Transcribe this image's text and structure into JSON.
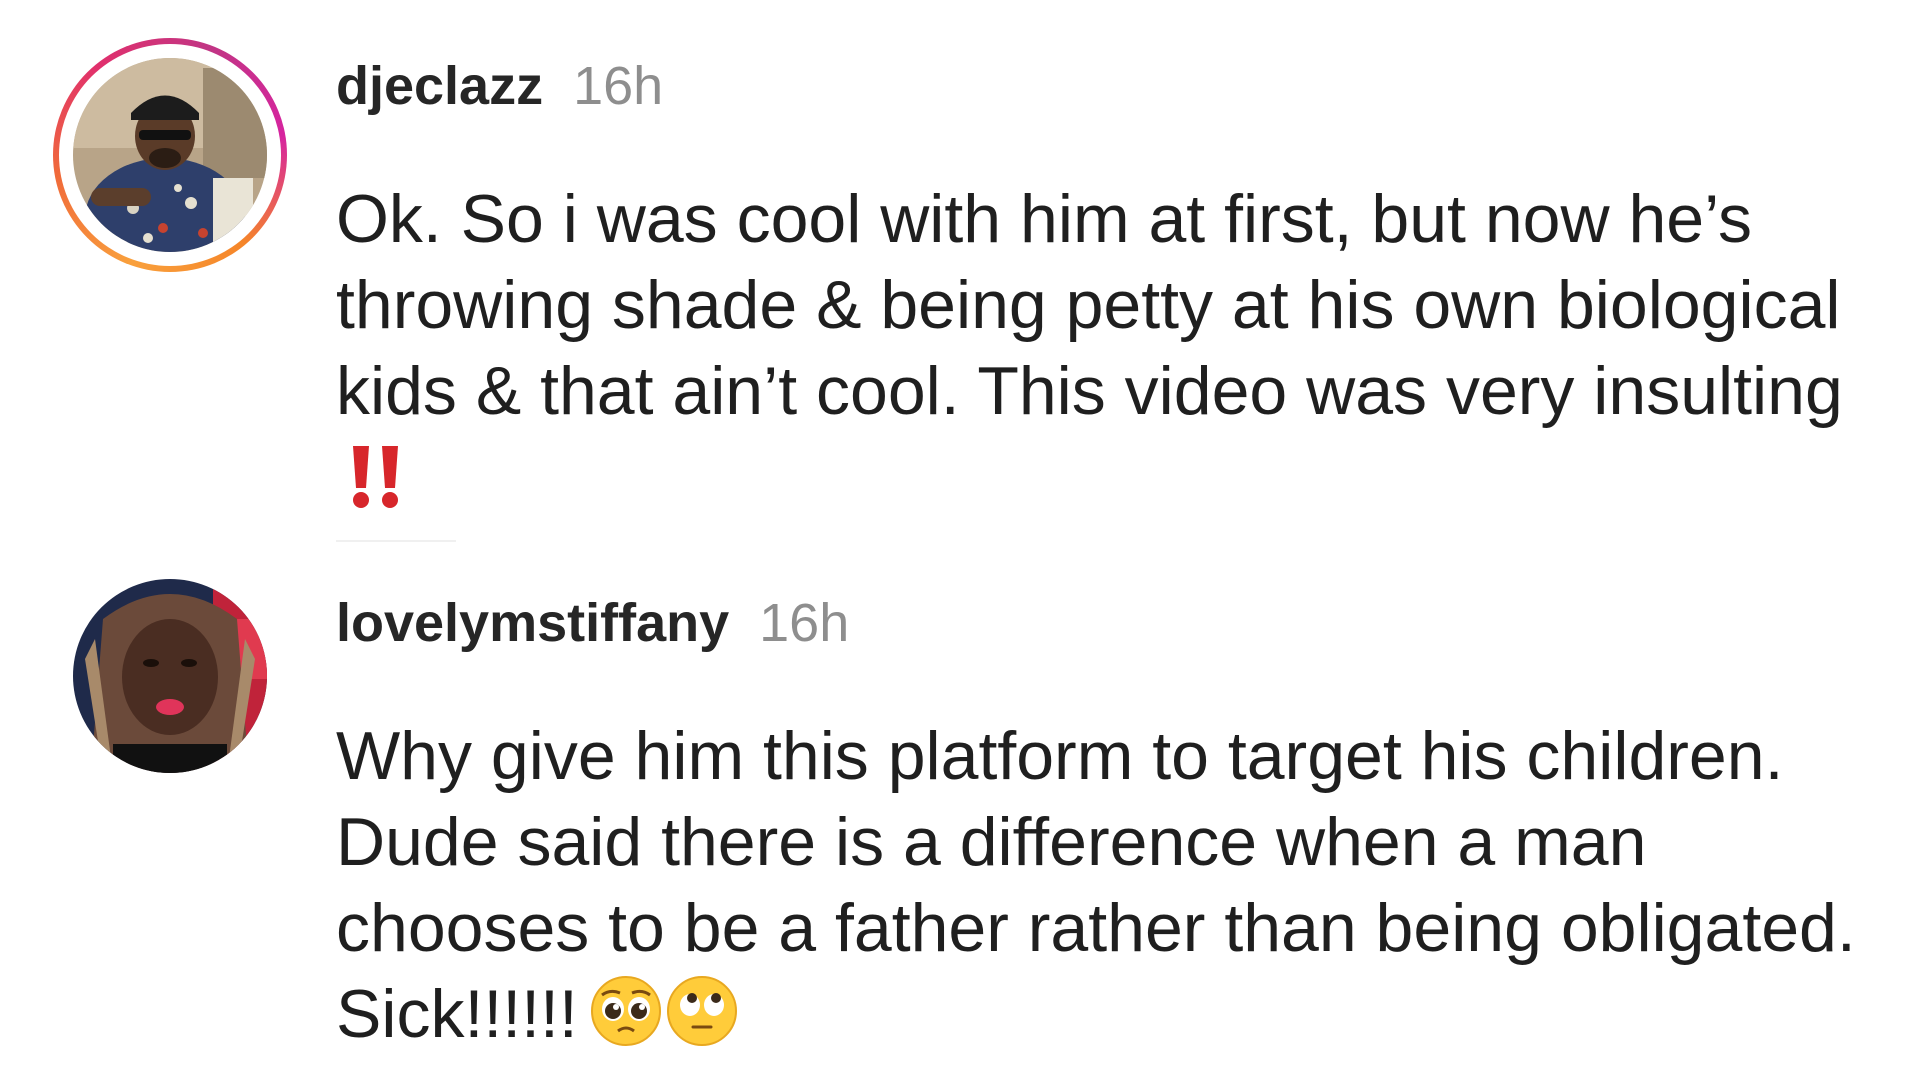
{
  "comments": [
    {
      "username": "djeclazz",
      "time": "16h",
      "text": "Ok. So i was cool with him at first, but now he’s throwing shade & being petty at his own biological kids & that ain’t cool. This video was very insulting",
      "emojis": [
        "double-exclamation-icon"
      ],
      "has_story_ring": true
    },
    {
      "username": "lovelymstiffany",
      "time": "16h",
      "text": "Why give him this platform to target his children. Dude said there is a difference when a man chooses to be a father rather than being obligated. Sick!!!!!!",
      "emojis": [
        "pleading-face-icon",
        "eye-roll-face-icon"
      ],
      "has_story_ring": false
    }
  ],
  "colors": {
    "username": "#262626",
    "timestamp": "#8e8e8e",
    "text": "#1f1f1f",
    "emoji_red": "#d7262b",
    "emoji_yellow": "#ffcc3a"
  }
}
